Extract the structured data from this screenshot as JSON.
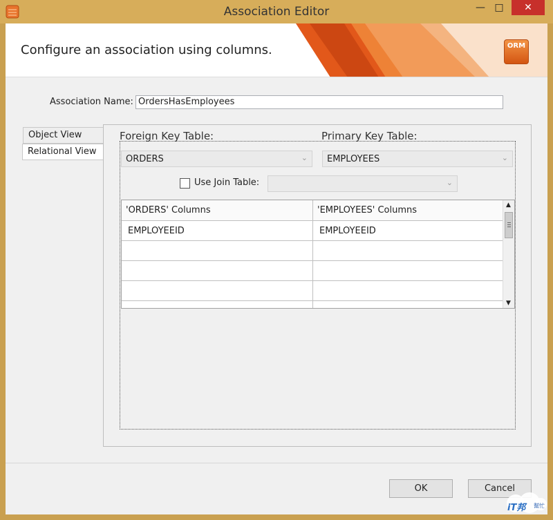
{
  "window": {
    "title": "Association Editor"
  },
  "header": {
    "title": "Configure an association using columns.",
    "badge": "ORM"
  },
  "association": {
    "name_label": "Association Name:",
    "name_value": "OrdersHasEmployees"
  },
  "tabs": [
    {
      "label": "Object View",
      "active": false
    },
    {
      "label": "Relational View",
      "active": true
    }
  ],
  "foreign_key": {
    "label": "Foreign Key Table:",
    "value": "ORDERS"
  },
  "primary_key": {
    "label": "Primary Key Table:",
    "value": "EMPLOYEES"
  },
  "join": {
    "label": "Use Join Table:",
    "checked": false,
    "value": ""
  },
  "grid": {
    "columns": [
      "'ORDERS' Columns",
      "'EMPLOYEES' Columns"
    ],
    "rows": [
      [
        "EMPLOYEEID",
        "EMPLOYEEID"
      ],
      [
        "",
        ""
      ],
      [
        "",
        ""
      ],
      [
        "",
        ""
      ]
    ]
  },
  "buttons": {
    "ok": "OK",
    "cancel": "Cancel"
  },
  "watermark": {
    "title": "iT邦",
    "subtitle": "幫忙"
  },
  "colors": {
    "title_bar": "#d7ad5a",
    "close_button": "#c7302b",
    "accent_orange": "#e2581a"
  }
}
